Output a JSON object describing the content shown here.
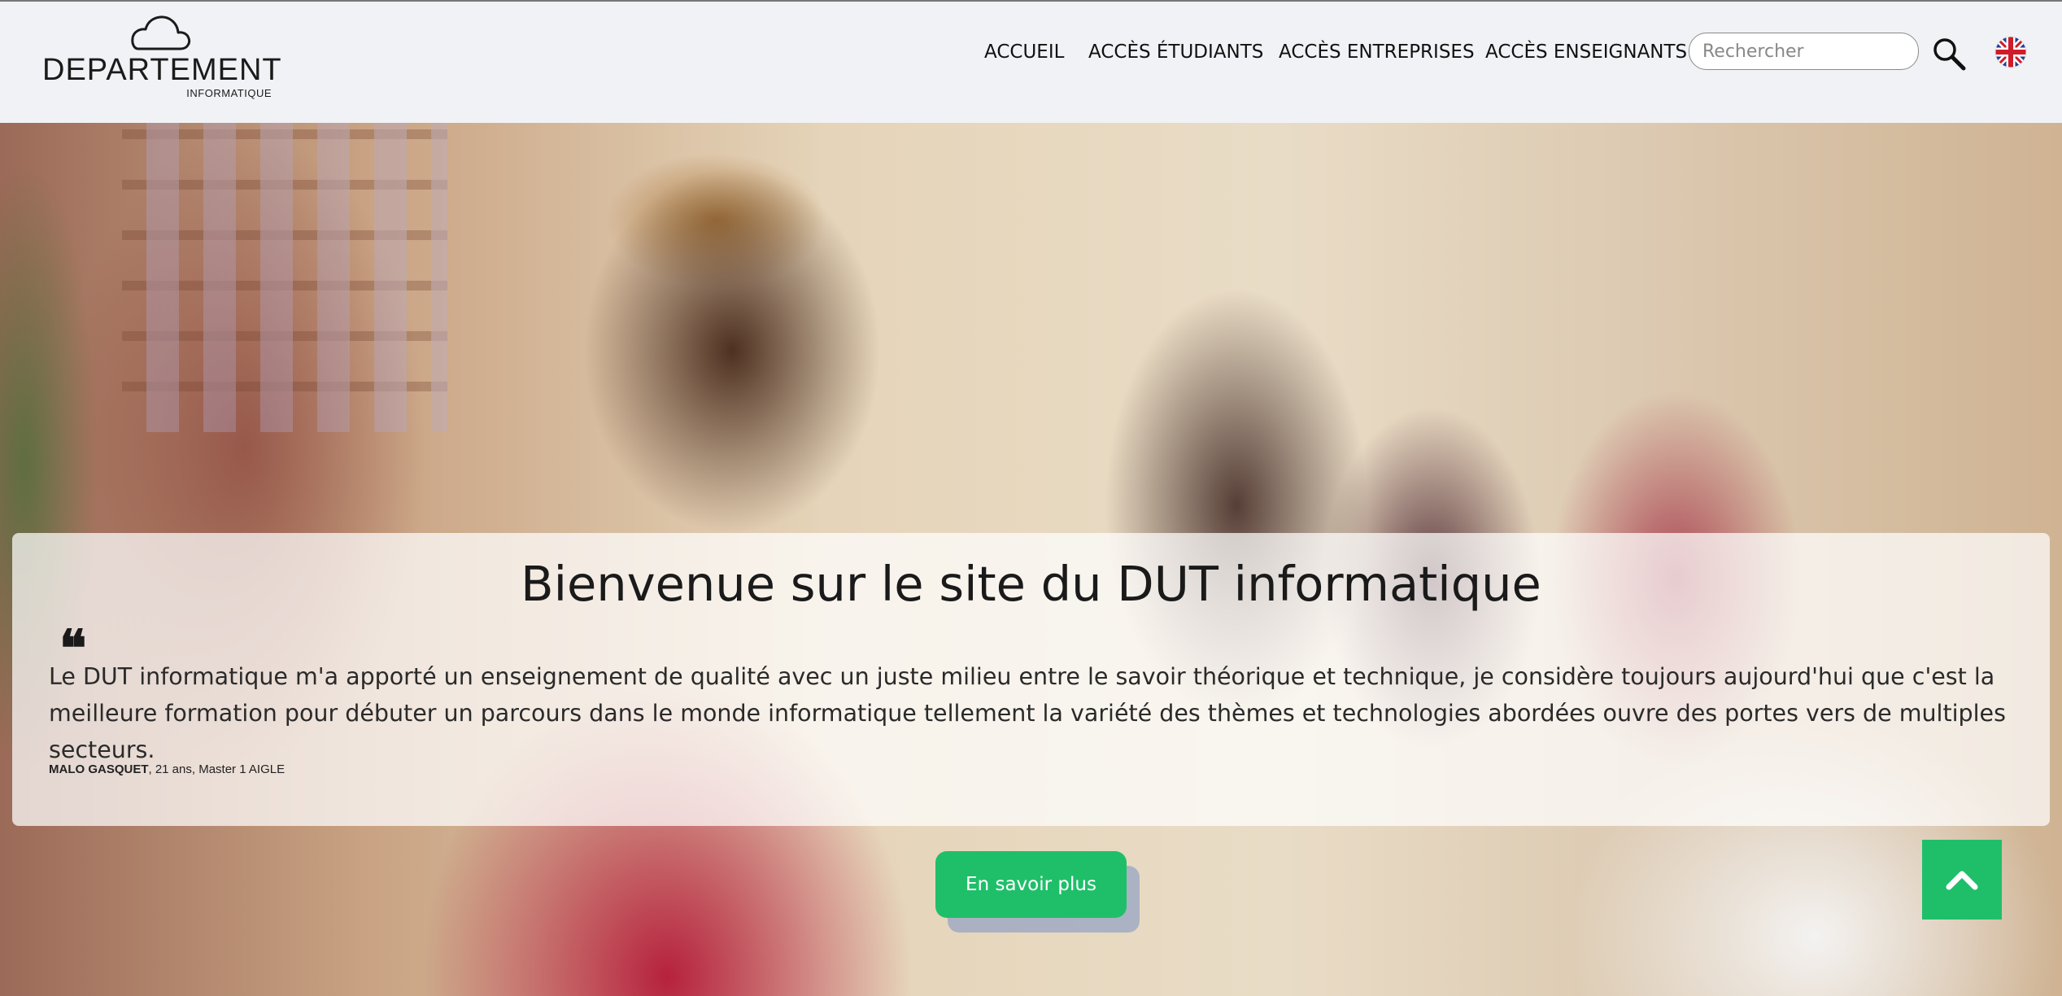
{
  "logo": {
    "title": "DEPARTEMENT",
    "subtitle": "INFORMATIQUE",
    "icon": "cloud-icon"
  },
  "nav": {
    "items": [
      {
        "label": "ACCUEIL"
      },
      {
        "label": "ACCÈS ÉTUDIANTS"
      },
      {
        "label": "ACCÈS ENTREPRISES"
      },
      {
        "label": "ACCÈS ENSEIGNANTS"
      }
    ]
  },
  "search": {
    "placeholder": "Rechercher",
    "value": "",
    "icon": "search-icon"
  },
  "language": {
    "icon": "uk-flag-icon"
  },
  "hero": {
    "title": "Bienvenue sur le site du DUT informatique",
    "quote_mark": "❝",
    "quote": "Le DUT informatique m'a apporté un enseignement de qualité avec un juste milieu entre le savoir théorique et technique, je considère toujours aujourd'hui que c'est la meilleure formation pour débuter un parcours dans le monde informatique tellement la variété des thèmes et technologies abordées ouvre des portes vers de multiples secteurs.",
    "author_name": "MALO GASQUET",
    "author_details": ", 21 ans, Master 1 AIGLE",
    "cta_label": "En savoir plus"
  },
  "scroll_top": {
    "icon": "chevron-up-icon"
  },
  "colors": {
    "header_bg": "#f1f2f6",
    "accent": "#1fbf6a",
    "text": "#1a1a1a"
  }
}
